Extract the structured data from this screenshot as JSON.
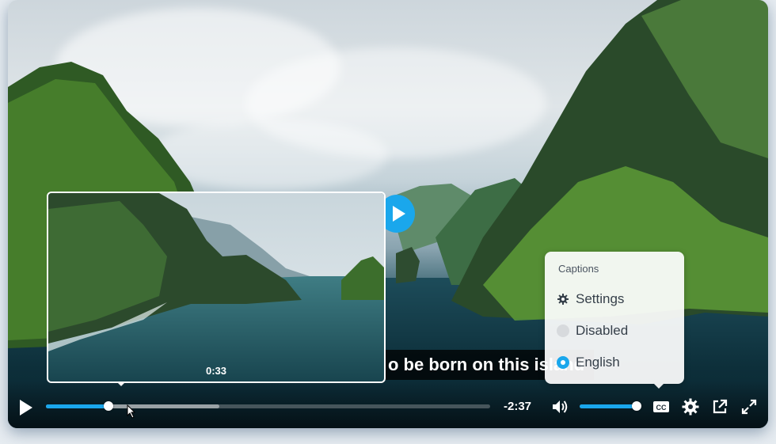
{
  "player": {
    "caption_text": "o be born on this island",
    "preview_time": "0:33",
    "time_remaining": "-2:37",
    "progress": 0.14,
    "buffered": 0.39,
    "volume": 1.0,
    "accent_color": "#1aa7ec"
  },
  "captions_menu": {
    "title": "Captions",
    "items": [
      {
        "label": "Settings",
        "icon": "gear-icon"
      },
      {
        "label": "Disabled",
        "icon": "radio-off-icon",
        "selected": false
      },
      {
        "label": "English",
        "icon": "radio-on-icon",
        "selected": true
      }
    ]
  },
  "icons": {
    "play": "play-icon",
    "volume": "volume-icon",
    "captions": "cc-icon",
    "settings": "gear-icon",
    "popout": "external-link-icon",
    "fullscreen": "fullscreen-icon"
  }
}
